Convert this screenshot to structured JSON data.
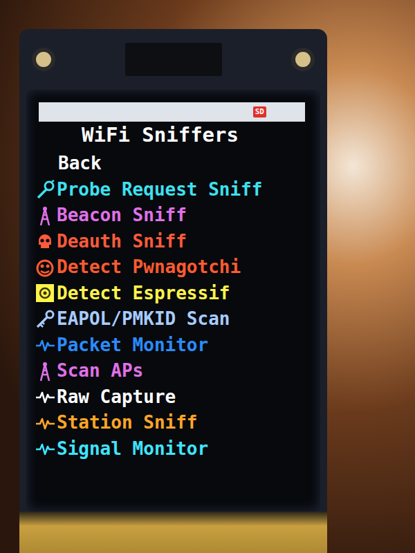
{
  "status": {
    "sd": "SD"
  },
  "title": "WiFi Sniffers",
  "menu": {
    "items": [
      {
        "label": "Back",
        "color": "#ffffff"
      },
      {
        "label": "Probe Request Sniff",
        "color": "#3fe0f0"
      },
      {
        "label": "Beacon Sniff",
        "color": "#e070e8"
      },
      {
        "label": "Deauth Sniff",
        "color": "#ff5a3a"
      },
      {
        "label": "Detect Pwnagotchi",
        "color": "#ff5a30"
      },
      {
        "label": "Detect Espressif",
        "color": "#fff44a"
      },
      {
        "label": "EAPOL/PMKID Scan",
        "color": "#a8ccff"
      },
      {
        "label": "Packet Monitor",
        "color": "#2a8cff"
      },
      {
        "label": "Scan APs",
        "color": "#e070e8"
      },
      {
        "label": "Raw Capture",
        "color": "#ffffff"
      },
      {
        "label": "Station Sniff",
        "color": "#ffa628"
      },
      {
        "label": "Signal Monitor",
        "color": "#40e4ff"
      }
    ]
  }
}
